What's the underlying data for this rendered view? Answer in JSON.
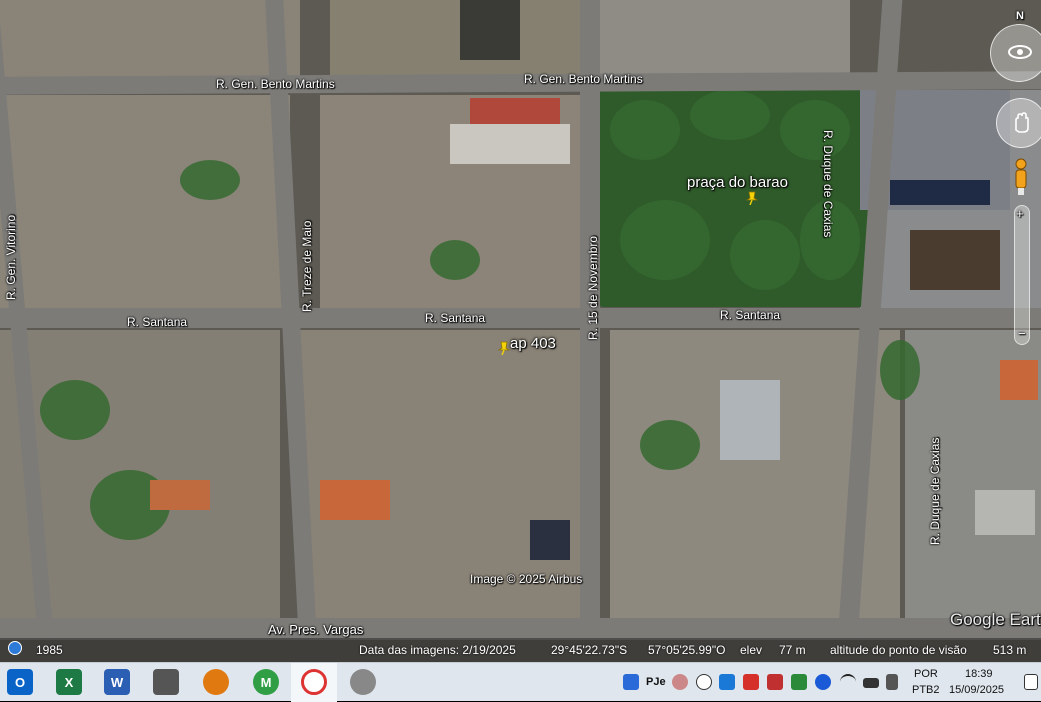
{
  "map": {
    "streets": {
      "gen_bento_martins_left": "R. Gen. Bento Martins",
      "gen_bento_martins_right": "R. Gen. Bento Martins",
      "santana_1": "R. Santana",
      "santana_2": "R. Santana",
      "santana_3": "R. Santana",
      "gen_vitorino": "R. Gen. Vitorino",
      "treze_de_maio": "R. Treze de Maio",
      "quinze_de_novembro": "R. 15 de Novembro",
      "duque_de_caxias_top": "R. Duque de Caxias",
      "duque_de_caxias_bottom": "R. Duque de Caxias",
      "pres_vargas": "Av. Pres. Vargas"
    },
    "placemarks": [
      {
        "name": "praça do barao"
      },
      {
        "name": "ap 403"
      }
    ],
    "copyright": "Image © 2025 Airbus",
    "brand": "Google Earth",
    "compass_label": "N"
  },
  "status_bar": {
    "year": "1985",
    "imagery_date": "Data das imagens: 2/19/2025",
    "lat": "29°45'22.73\"S",
    "lon": "57°05'25.99\"O",
    "elev_label": "elev",
    "elev_value": "77 m",
    "eye_alt_label": "altitude do ponto de visão",
    "eye_alt_value": "513 m"
  },
  "taskbar": {
    "apps": [
      {
        "name": "outlook-icon",
        "glyph": "O",
        "color": "#0a64c8"
      },
      {
        "name": "excel-icon",
        "glyph": "X",
        "color": "#1d7a44"
      },
      {
        "name": "word-icon",
        "glyph": "W",
        "color": "#2b5fb4"
      },
      {
        "name": "scanner-icon",
        "glyph": "",
        "color": "#555555"
      },
      {
        "name": "gear-app-icon",
        "glyph": "",
        "color": "#e07a10"
      },
      {
        "name": "chrome-icon",
        "glyph": "M",
        "color": "#2f9e44"
      },
      {
        "name": "google-earth-icon",
        "glyph": "",
        "color": "#d33"
      },
      {
        "name": "pro-app-icon",
        "glyph": "",
        "color": "#888888"
      }
    ],
    "tray": {
      "pje_label": "PJe",
      "language": "POR",
      "layout": "PTB2",
      "time": "18:39",
      "date": "15/09/2025"
    }
  }
}
